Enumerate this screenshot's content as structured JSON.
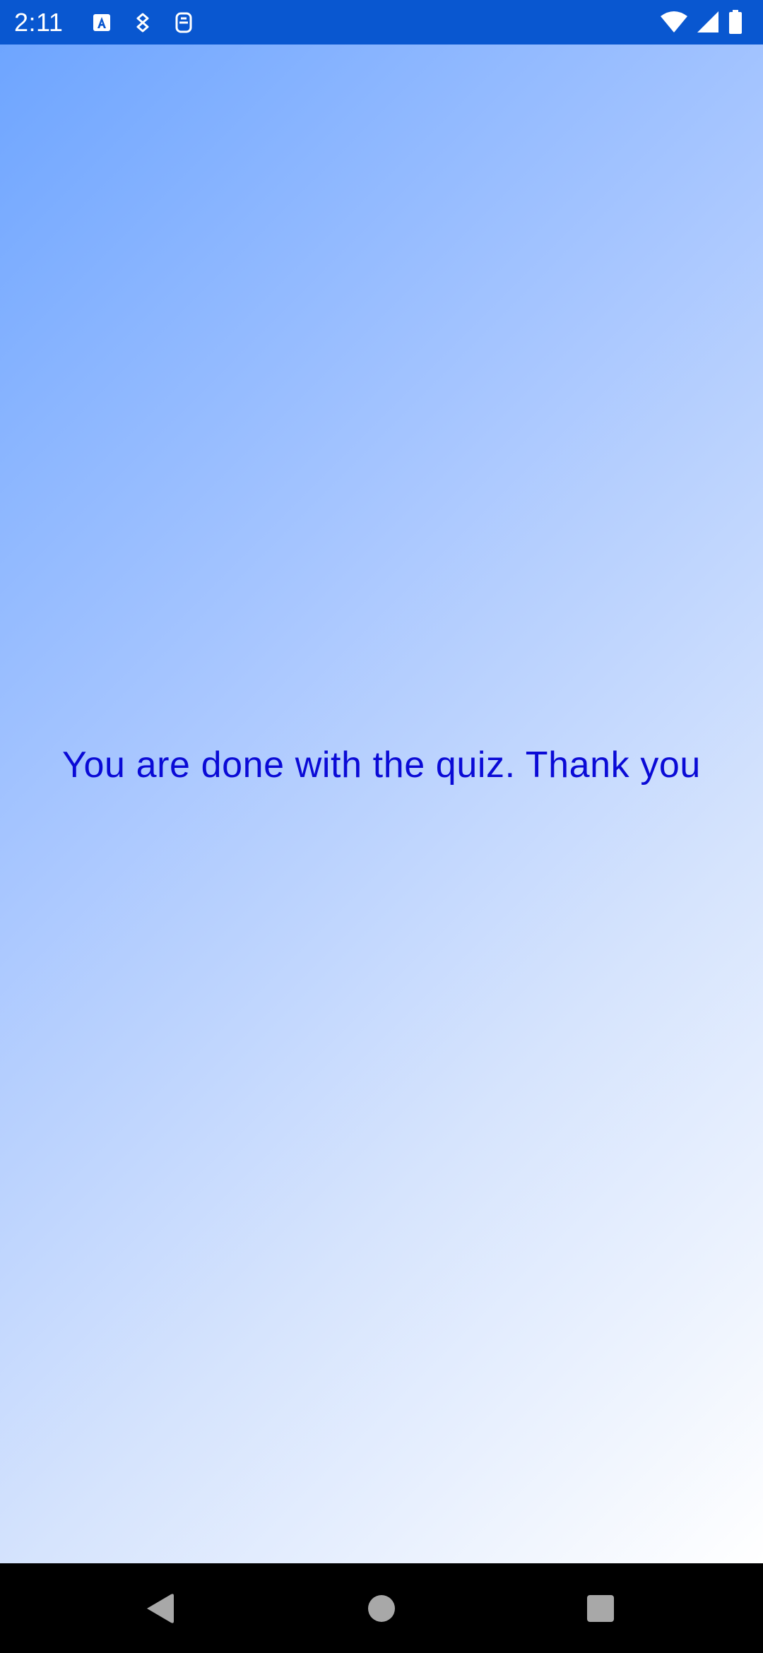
{
  "status_bar": {
    "time": "2:11",
    "background_color": "#0957d0",
    "left_icons": [
      "a-badge-icon",
      "download-notification-icon",
      "screenshot-notification-icon"
    ],
    "right_icons": [
      "wifi-icon",
      "cell-signal-icon",
      "battery-icon"
    ]
  },
  "main": {
    "message": "You are done with the quiz. Thank you",
    "message_color": "#0a0ad6",
    "background_gradient": [
      "#6ea5ff",
      "#ffffff"
    ]
  },
  "nav_bar": {
    "buttons": [
      "back-icon",
      "home-icon",
      "recents-icon"
    ]
  }
}
